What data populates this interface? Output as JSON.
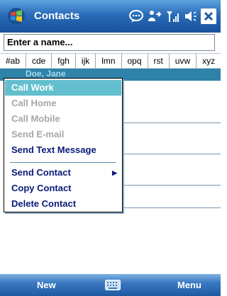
{
  "titlebar": {
    "title": "Contacts",
    "icons": [
      "start-menu-icon",
      "notification-bubble-icon",
      "connectivity-icon",
      "signal-icon",
      "volume-icon",
      "close-icon"
    ]
  },
  "search": {
    "placeholder": "Enter a name..."
  },
  "tabs": [
    "#ab",
    "cde",
    "fgh",
    "ijk",
    "lmn",
    "opq",
    "rst",
    "uvw",
    "xyz"
  ],
  "list": {
    "visible_partial_name": "Doe, Jane"
  },
  "menu": {
    "items": [
      {
        "label": "Call Work",
        "state": "selected"
      },
      {
        "label": "Call Home",
        "state": "disabled"
      },
      {
        "label": "Call Mobile",
        "state": "disabled"
      },
      {
        "label": "Send E-mail",
        "state": "disabled"
      },
      {
        "label": "Send Text Message",
        "state": "enabled"
      },
      {
        "label": "Send Contact",
        "state": "enabled",
        "submenu": true
      },
      {
        "label": "Copy Contact",
        "state": "enabled"
      },
      {
        "label": "Delete Contact",
        "state": "enabled"
      }
    ]
  },
  "bottombar": {
    "left_softkey": "New",
    "right_softkey": "Menu",
    "center_icon": "keyboard-icon"
  },
  "colors": {
    "title_bar": "#2a6cb9",
    "menu_selected": "#63bfce",
    "menu_text": "#0a1a78",
    "menu_disabled": "#a7a7a7"
  }
}
